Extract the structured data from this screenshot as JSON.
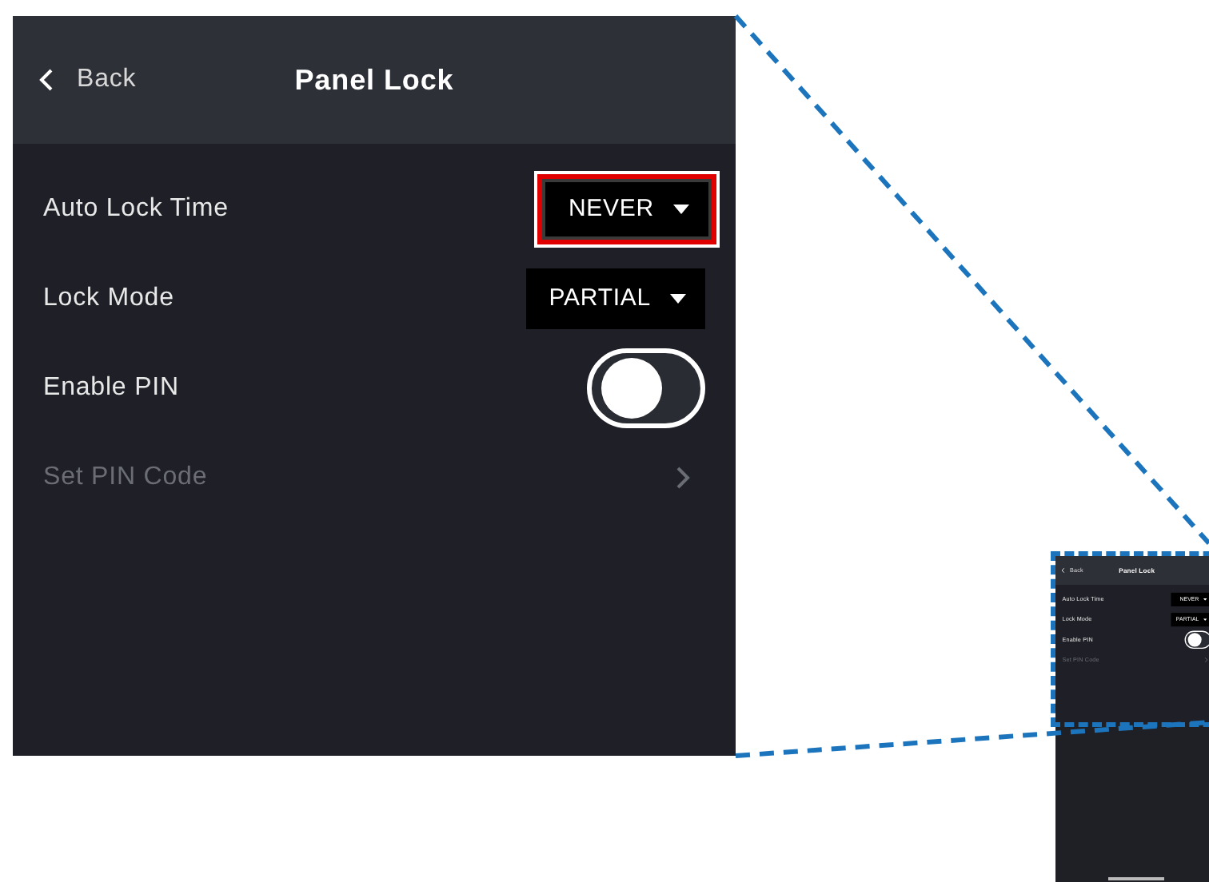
{
  "panel": {
    "back": "Back",
    "title": "Panel Lock",
    "settings": [
      {
        "kind": "dropdown",
        "label": "Auto Lock Time",
        "value": "NEVER",
        "highlighted": true,
        "disabled": false
      },
      {
        "kind": "dropdown",
        "label": "Lock Mode",
        "value": "PARTIAL",
        "highlighted": false,
        "disabled": false
      },
      {
        "kind": "toggle",
        "label": "Enable PIN",
        "on": false,
        "disabled": false
      },
      {
        "kind": "link",
        "label": "Set PIN Code",
        "disabled": true
      }
    ]
  },
  "preview": {
    "back": "Back",
    "title": "Panel Lock",
    "settings": [
      {
        "kind": "dropdown",
        "label": "Auto Lock Time",
        "value": "NEVER",
        "highlighted": false,
        "disabled": false
      },
      {
        "kind": "dropdown",
        "label": "Lock Mode",
        "value": "PARTIAL",
        "highlighted": false,
        "disabled": false
      },
      {
        "kind": "toggle",
        "label": "Enable PIN",
        "on": false,
        "disabled": false
      },
      {
        "kind": "link",
        "label": "Set PIN Code",
        "disabled": true
      }
    ]
  }
}
